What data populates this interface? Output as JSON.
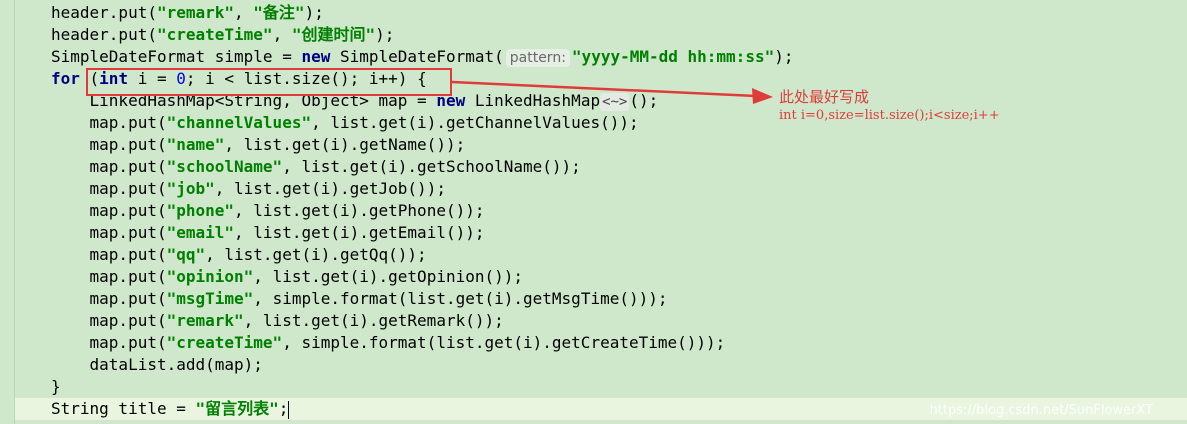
{
  "code_lines": [
    {
      "parts": [
        {
          "t": "header.put(",
          "c": ""
        },
        {
          "t": "\"remark\"",
          "c": "str"
        },
        {
          "t": ", ",
          "c": ""
        },
        {
          "t": "\"备注\"",
          "c": "str"
        },
        {
          "t": ");",
          "c": ""
        }
      ]
    },
    {
      "parts": [
        {
          "t": "header.put(",
          "c": ""
        },
        {
          "t": "\"createTime\"",
          "c": "str"
        },
        {
          "t": ", ",
          "c": ""
        },
        {
          "t": "\"创建时间\"",
          "c": "str"
        },
        {
          "t": ");",
          "c": ""
        }
      ]
    },
    {
      "parts": [
        {
          "t": "SimpleDateFormat simple = ",
          "c": ""
        },
        {
          "t": "new",
          "c": "kw"
        },
        {
          "t": " SimpleDateFormat(",
          "c": ""
        },
        {
          "t": "pattern:",
          "c": "hint"
        },
        {
          "t": "\"yyyy-MM-dd hh:mm:ss\"",
          "c": "str"
        },
        {
          "t": ");",
          "c": ""
        }
      ]
    },
    {
      "parts": [
        {
          "t": "for",
          "c": "kw"
        },
        {
          "t": " (",
          "c": ""
        },
        {
          "t": "int",
          "c": "kw"
        },
        {
          "t": " i = ",
          "c": ""
        },
        {
          "t": "0",
          "c": "num"
        },
        {
          "t": "; i < list.size(); i++) {",
          "c": ""
        }
      ]
    },
    {
      "parts": [
        {
          "t": "    LinkedHashMap<String, Object> map = ",
          "c": ""
        },
        {
          "t": "new",
          "c": "kw"
        },
        {
          "t": " LinkedHashMap",
          "c": ""
        },
        {
          "t": "<~>",
          "c": "fold"
        },
        {
          "t": "();",
          "c": ""
        }
      ]
    },
    {
      "parts": [
        {
          "t": "    map.put(",
          "c": ""
        },
        {
          "t": "\"channelValues\"",
          "c": "str"
        },
        {
          "t": ", list.get(i).getChannelValues());",
          "c": ""
        }
      ]
    },
    {
      "parts": [
        {
          "t": "    map.put(",
          "c": ""
        },
        {
          "t": "\"name\"",
          "c": "str"
        },
        {
          "t": ", list.get(i).getName());",
          "c": ""
        }
      ]
    },
    {
      "parts": [
        {
          "t": "    map.put(",
          "c": ""
        },
        {
          "t": "\"schoolName\"",
          "c": "str"
        },
        {
          "t": ", list.get(i).getSchoolName());",
          "c": ""
        }
      ]
    },
    {
      "parts": [
        {
          "t": "    map.put(",
          "c": ""
        },
        {
          "t": "\"job\"",
          "c": "str"
        },
        {
          "t": ", list.get(i).getJob());",
          "c": ""
        }
      ]
    },
    {
      "parts": [
        {
          "t": "    map.put(",
          "c": ""
        },
        {
          "t": "\"phone\"",
          "c": "str"
        },
        {
          "t": ", list.get(i).getPhone());",
          "c": ""
        }
      ]
    },
    {
      "parts": [
        {
          "t": "    map.put(",
          "c": ""
        },
        {
          "t": "\"email\"",
          "c": "str"
        },
        {
          "t": ", list.get(i).getEmail());",
          "c": ""
        }
      ]
    },
    {
      "parts": [
        {
          "t": "    map.put(",
          "c": ""
        },
        {
          "t": "\"qq\"",
          "c": "str"
        },
        {
          "t": ", list.get(i).getQq());",
          "c": ""
        }
      ]
    },
    {
      "parts": [
        {
          "t": "    map.put(",
          "c": ""
        },
        {
          "t": "\"opinion\"",
          "c": "str"
        },
        {
          "t": ", list.get(i).getOpinion());",
          "c": ""
        }
      ]
    },
    {
      "parts": [
        {
          "t": "    map.put(",
          "c": ""
        },
        {
          "t": "\"msgTime\"",
          "c": "str"
        },
        {
          "t": ", simple.format(list.get(i).getMsgTime()));",
          "c": ""
        }
      ]
    },
    {
      "parts": [
        {
          "t": "    map.put(",
          "c": ""
        },
        {
          "t": "\"remark\"",
          "c": "str"
        },
        {
          "t": ", list.get(i).getRemark());",
          "c": ""
        }
      ]
    },
    {
      "parts": [
        {
          "t": "    map.put(",
          "c": ""
        },
        {
          "t": "\"createTime\"",
          "c": "str"
        },
        {
          "t": ", simple.format(list.get(i).getCreateTime()));",
          "c": ""
        }
      ]
    },
    {
      "parts": [
        {
          "t": "    dataList.add(map);",
          "c": ""
        }
      ]
    },
    {
      "parts": [
        {
          "t": "}",
          "c": ""
        }
      ]
    },
    {
      "parts": [
        {
          "t": "String title = ",
          "c": ""
        },
        {
          "t": "\"留言列表\"",
          "c": "str"
        },
        {
          "t": ";",
          "c": ""
        }
      ],
      "current": true
    }
  ],
  "annotation": {
    "title": "此处最好写成",
    "code": "int i=0,size=list.size();i<size;i++",
    "color": "#e03b3b"
  },
  "watermark": "https://blog.csdn.net/SunFlowerXT",
  "colors": {
    "background": "#cfe8cc",
    "keyword": "#000080",
    "string": "#008000",
    "number": "#0000ff",
    "highlight": "#e03b3b"
  }
}
